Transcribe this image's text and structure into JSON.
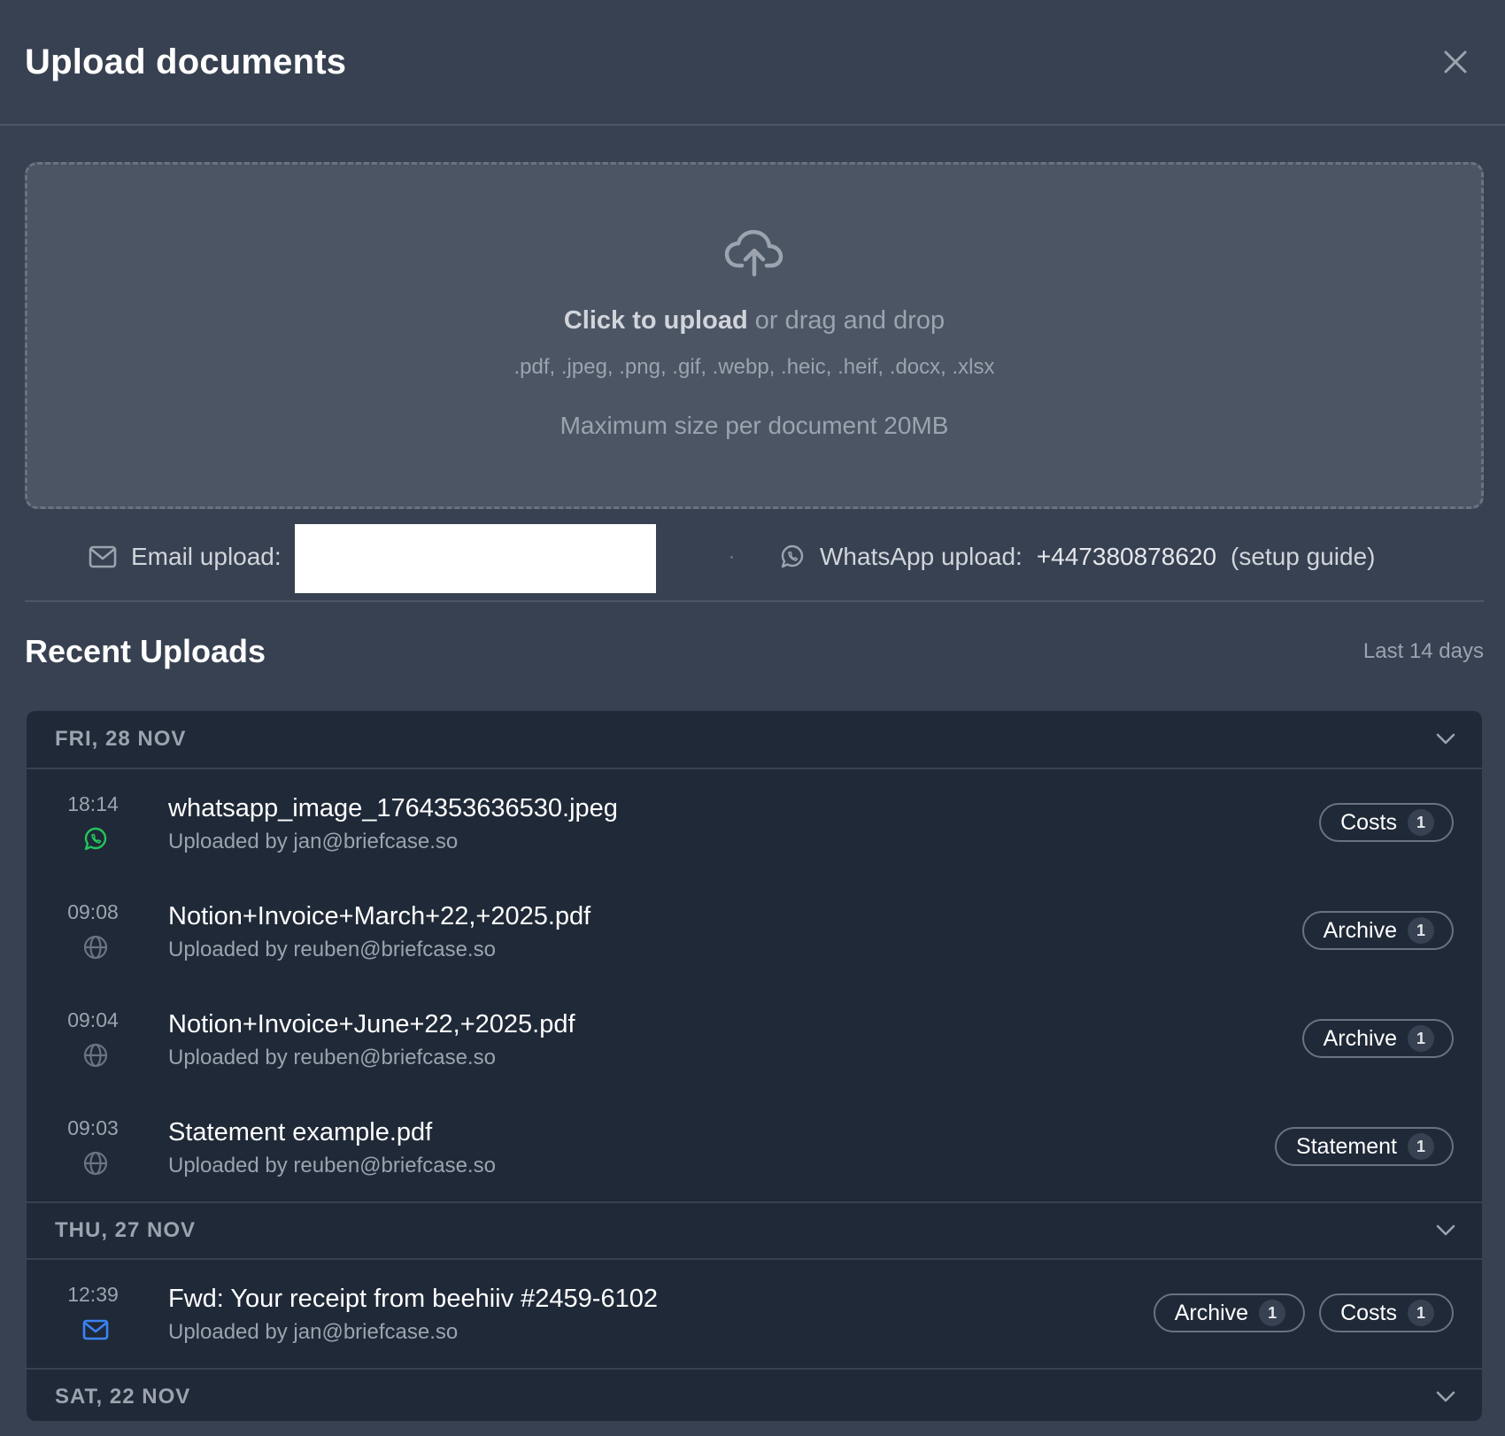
{
  "header": {
    "title": "Upload documents"
  },
  "dropzone": {
    "click_text": "Click to upload",
    "drag_text": " or drag and drop",
    "formats": ".pdf, .jpeg, .png, .gif, .webp, .heic, .heif, .docx, .xlsx",
    "max_size": "Maximum size per document 20MB"
  },
  "methods": {
    "email_label": "Email upload:",
    "whatsapp_label": "WhatsApp upload:",
    "whatsapp_number": "+447380878620",
    "setup_guide": "(setup guide)"
  },
  "recent": {
    "title": "Recent Uploads",
    "range": "Last 14 days",
    "groups": [
      {
        "date": "FRI, 28 NOV",
        "items": [
          {
            "time": "18:14",
            "source": "whatsapp-icon",
            "name": "whatsapp_image_1764353636530.jpeg",
            "by": "Uploaded by jan@briefcase.so",
            "tags": [
              {
                "name": "Costs",
                "count": "1"
              }
            ]
          },
          {
            "time": "09:08",
            "source": "globe-icon",
            "name": "Notion+Invoice+March+22,+2025.pdf",
            "by": "Uploaded by reuben@briefcase.so",
            "tags": [
              {
                "name": "Archive",
                "count": "1"
              }
            ]
          },
          {
            "time": "09:04",
            "source": "globe-icon",
            "name": "Notion+Invoice+June+22,+2025.pdf",
            "by": "Uploaded by reuben@briefcase.so",
            "tags": [
              {
                "name": "Archive",
                "count": "1"
              }
            ]
          },
          {
            "time": "09:03",
            "source": "globe-icon",
            "name": "Statement example.pdf",
            "by": "Uploaded by reuben@briefcase.so",
            "tags": [
              {
                "name": "Statement",
                "count": "1"
              }
            ]
          }
        ]
      },
      {
        "date": "THU, 27 NOV",
        "items": [
          {
            "time": "12:39",
            "source": "mail-icon",
            "name": "Fwd: Your receipt from beehiiv #2459-6102",
            "by": "Uploaded by jan@briefcase.so",
            "tags": [
              {
                "name": "Archive",
                "count": "1"
              },
              {
                "name": "Costs",
                "count": "1"
              }
            ]
          }
        ]
      },
      {
        "date": "SAT, 22 NOV",
        "items": []
      }
    ]
  },
  "colors": {
    "background": "#374151",
    "list_bg": "#1f2937",
    "whatsapp_green": "#22c55e",
    "mail_blue": "#3b82f6"
  }
}
